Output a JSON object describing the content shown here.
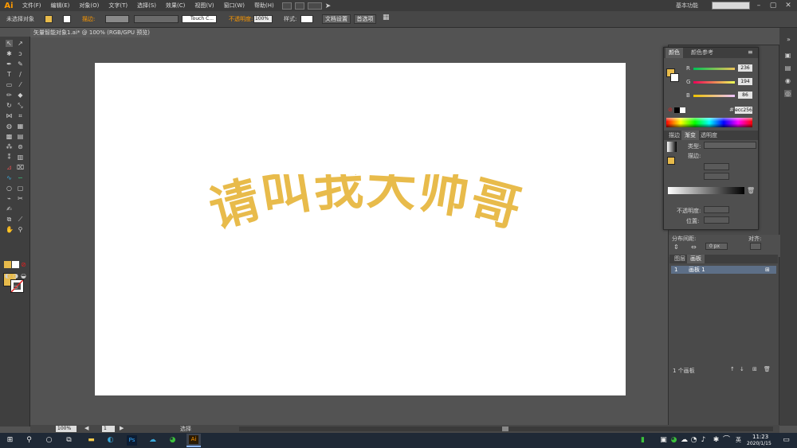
{
  "app": {
    "logo": "Ai",
    "workspace": "基本功能"
  },
  "menu": [
    "文件(F)",
    "编辑(E)",
    "对象(O)",
    "文字(T)",
    "选择(S)",
    "效果(C)",
    "视图(V)",
    "窗口(W)",
    "帮助(H)"
  ],
  "control": {
    "selection": "未选择对象",
    "stroke_label": "描边:",
    "brush": "Touch C...",
    "opacity_label": "不透明度:",
    "opacity_value": "100%",
    "style_label": "样式:",
    "doc_setup": "文档设置",
    "preferences": "首选项"
  },
  "document": {
    "tab": "矢量智能对象1.ai* @ 100% (RGB/GPU 预览)",
    "artwork_text": "请叫我大帅哥"
  },
  "color_panel": {
    "tabs": [
      "颜色",
      "颜色参考"
    ],
    "r": {
      "label": "R",
      "value": "236"
    },
    "g": {
      "label": "G",
      "value": "194"
    },
    "b": {
      "label": "B",
      "value": "86"
    },
    "hex_prefix": "#",
    "hex": "ecc256"
  },
  "gradient_panel": {
    "tabs": [
      "描边",
      "渐变",
      "透明度"
    ],
    "type_label": "类型:",
    "stroke_label": "描边:",
    "opacity_label": "不透明度:",
    "position_label": "位置:"
  },
  "align_panel": {
    "distribute_label": "分布间距:",
    "align_label": "对齐:",
    "spacing": "0 px"
  },
  "layers_panel": {
    "tabs": [
      "图层",
      "画板"
    ],
    "row_index": "1",
    "row_name": "画板 1",
    "footer": "1 个画板"
  },
  "status": {
    "zoom": "100%",
    "artboard_no": "1",
    "tool": "选择"
  },
  "taskbar": {
    "time": "11:23",
    "date": "2020/1/15"
  },
  "colors": {
    "fill": "#e8bb4b",
    "accent": "#ff9a00"
  }
}
